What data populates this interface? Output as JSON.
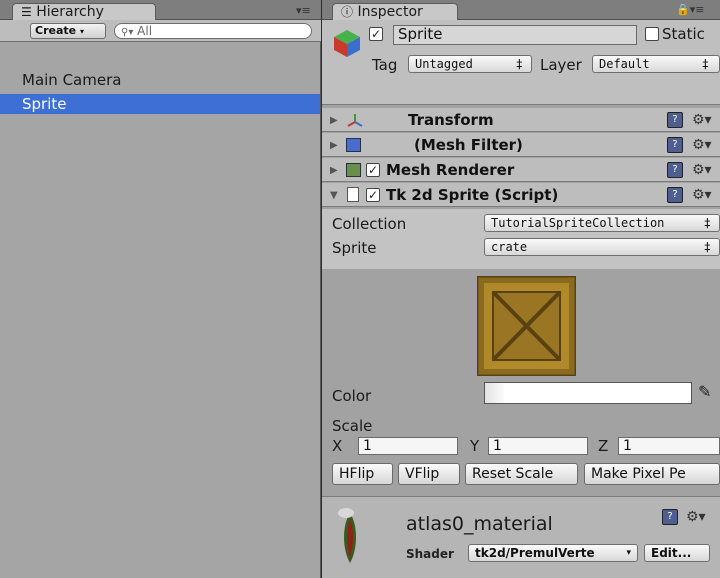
{
  "hierarchy": {
    "tab_label": "Hierarchy",
    "create_label": "Create",
    "search_placeholder": "All",
    "items": [
      {
        "label": "Main Camera"
      },
      {
        "label": "Sprite"
      }
    ],
    "selected": "Sprite"
  },
  "inspector": {
    "tab_label": "Inspector",
    "object_name": "Sprite",
    "static_label": "Static",
    "tag_label": "Tag",
    "tag_value": "Untagged",
    "layer_label": "Layer",
    "layer_value": "Default",
    "components": [
      {
        "label": "Transform"
      },
      {
        "label": "(Mesh Filter)"
      },
      {
        "label": "Mesh Renderer"
      },
      {
        "label": "Tk 2d Sprite (Script)"
      }
    ],
    "collection_label": "Collection",
    "collection_value": "TutorialSpriteCollection",
    "sprite_label": "Sprite",
    "sprite_value": "crate",
    "color_label": "Color",
    "scale_label": "Scale",
    "scale_x_label": "X",
    "scale_x": "1",
    "scale_y_label": "Y",
    "scale_y": "1",
    "scale_z_label": "Z",
    "scale_z": "1",
    "buttons": {
      "hflip": "HFlip",
      "vflip": "VFlip",
      "reset_scale": "Reset Scale",
      "make_pixel": "Make Pixel Pe"
    },
    "material": {
      "name": "atlas0_material",
      "shader_label": "Shader",
      "shader_value": "tk2d/PremulVerte",
      "edit_label": "Edit..."
    }
  },
  "colors": {
    "selection": "#3d6fd4",
    "panel": "#a2a2a2",
    "crate": "#b08a2a"
  }
}
